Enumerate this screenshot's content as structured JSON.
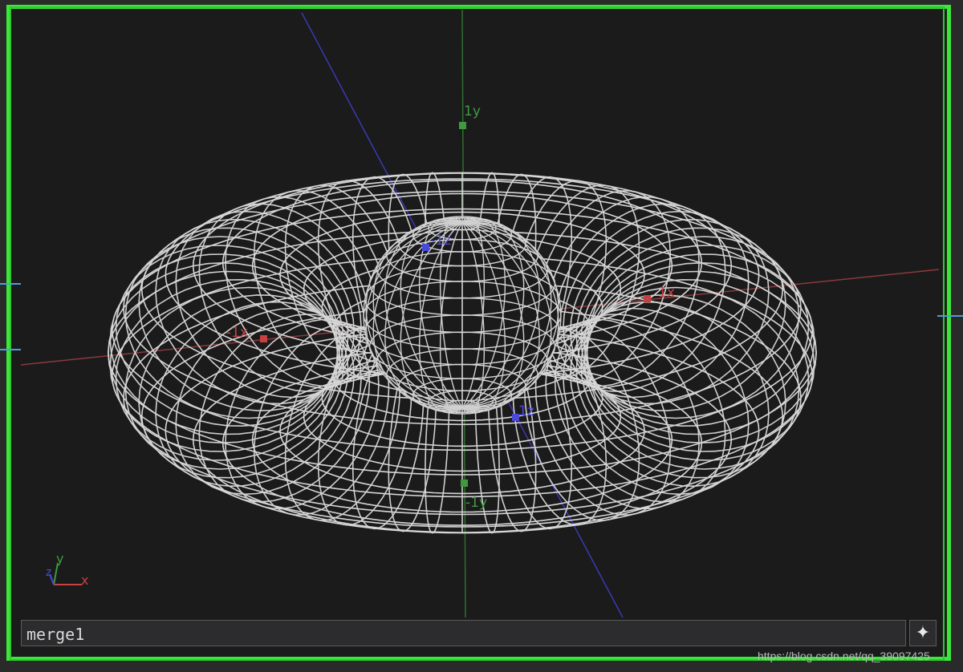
{
  "viewer": {
    "node_name": "merge1",
    "add_button_icon": "sparkle-plus-icon",
    "frame_color": "#3ae83a",
    "background_color": "#1b1b1c"
  },
  "axes": {
    "y_pos_label": "1y",
    "y_neg_label": "-1y",
    "x_pos_label": "1x",
    "x_neg_label": "-1x",
    "z_pos_label": "1z",
    "z_neg_label": "-1z",
    "x_color": "#c94040",
    "y_color": "#3f9a3f",
    "z_color": "#4a4ad8"
  },
  "gizmo": {
    "x_label": "x",
    "y_label": "y",
    "z_label": "z"
  },
  "watermark": "https://blog.csdn.net/qq_39097425"
}
